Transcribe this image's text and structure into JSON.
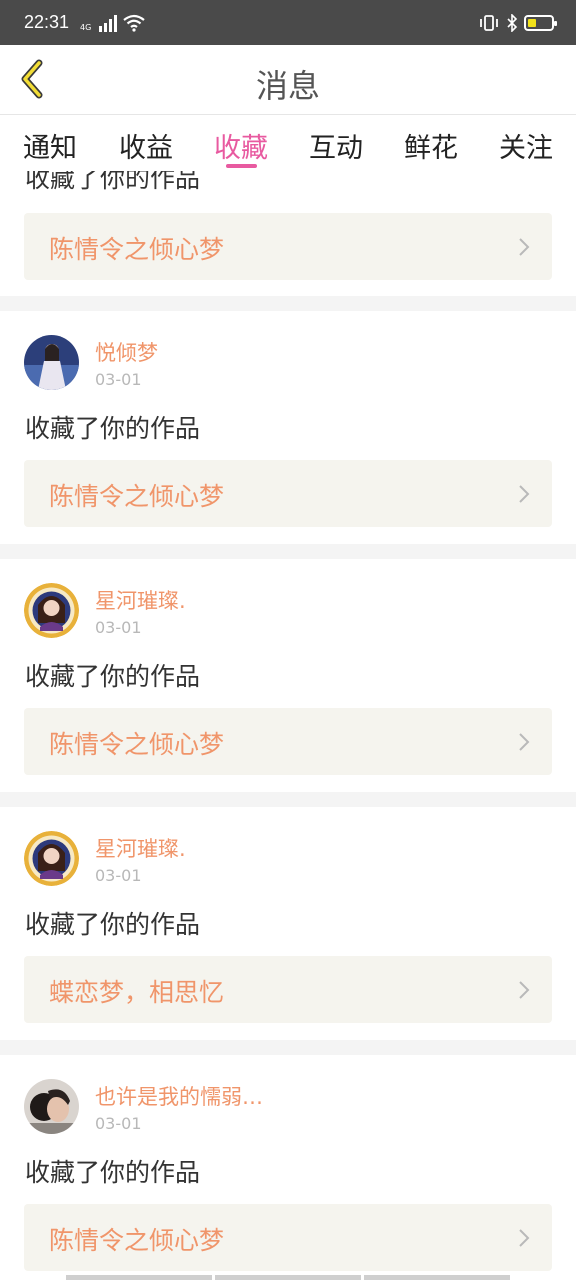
{
  "status_bar": {
    "time": "22:31",
    "network": "4G",
    "battery_level": 0.25,
    "battery_color": "#f2e21a"
  },
  "header": {
    "title": "消息",
    "back_icon": "chevron-left-icon",
    "back_icon_color": "#f2dd36"
  },
  "tabs": {
    "items": [
      "通知",
      "收益",
      "收藏",
      "互动",
      "鲜花",
      "关注"
    ],
    "active_index": 2,
    "active_color": "#e85aa0"
  },
  "feed": {
    "partial_top": {
      "action": "收藏了你的作品",
      "work_title": "陈情令之倾心梦"
    },
    "items": [
      {
        "username": "悦倾梦",
        "date": "03-01",
        "action": "收藏了你的作品",
        "work_title": "陈情令之倾心梦",
        "avatar": "avatar-girl-white-dress"
      },
      {
        "username": "星河璀璨.",
        "date": "03-01",
        "action": "收藏了你的作品",
        "work_title": "陈情令之倾心梦",
        "avatar": "avatar-anime-girl-gold-frame"
      },
      {
        "username": "星河璀璨.",
        "date": "03-01",
        "action": "收藏了你的作品",
        "work_title": "蝶恋梦，相思忆",
        "avatar": "avatar-anime-girl-gold-frame"
      },
      {
        "username": "也许是我的懦弱…",
        "date": "03-01",
        "action": "收藏了你的作品",
        "work_title": "陈情令之倾心梦",
        "avatar": "avatar-couple-photo"
      }
    ],
    "accent_color": "#f0956a"
  }
}
